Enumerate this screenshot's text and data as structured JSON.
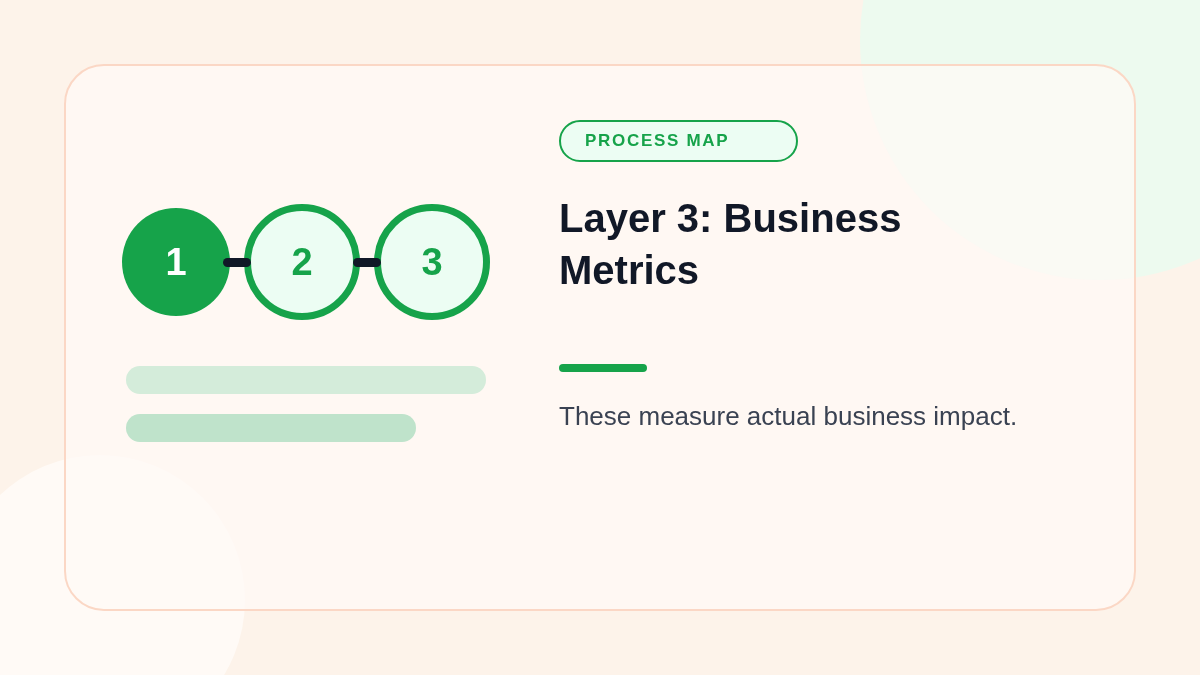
{
  "steps": [
    {
      "label": "1",
      "active": true
    },
    {
      "label": "2",
      "active": false
    },
    {
      "label": "3",
      "active": false
    }
  ],
  "badge": {
    "label": "PROCESS MAP"
  },
  "title": "Layer 3: Business Metrics",
  "description": "These measure actual business impact."
}
